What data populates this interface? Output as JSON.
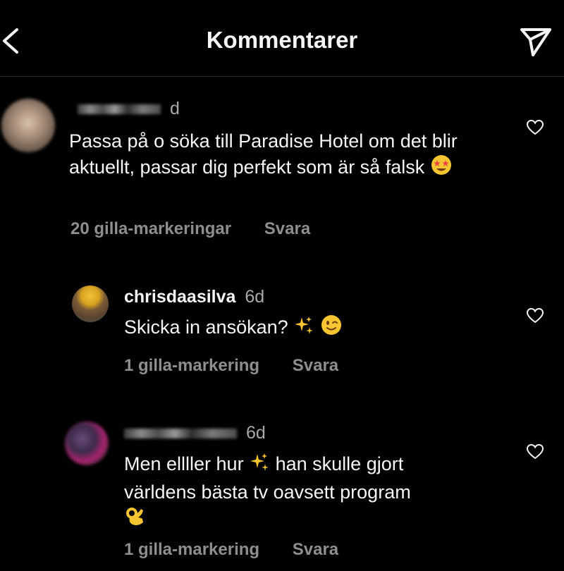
{
  "header": {
    "title": "Kommentarer",
    "back_icon": "chevron-left-icon",
    "send_icon": "direct-send-icon"
  },
  "comments": [
    {
      "time": "d",
      "text": "Passa på o söka till Paradise Hotel om det blir aktuellt, passar dig perfekt som är så falsk",
      "emoji": "star-struck-emoji",
      "likes": "20 gilla-markeringar",
      "reply": "Svara"
    },
    {
      "username": "chrisdaasilva",
      "time": "6d",
      "text": "Skicka in ansökan?",
      "emoji": "sparkles-emoji, winking-face-emoji",
      "likes": "1 gilla-markering",
      "reply": "Svara"
    },
    {
      "time": "6d",
      "text_line1": "Men ellller hur",
      "text_line1b": "han skulle gjort",
      "text_line2": "världens bästa tv oavsett program",
      "emoji": "sparkles-emoji, ok-hand-emoji",
      "likes": "1 gilla-markering",
      "reply": "Svara"
    }
  ],
  "colors": {
    "background": "#000000",
    "text": "#f5f5f5",
    "secondary": "#8e8e8e",
    "heart": "#f5f5f5"
  }
}
